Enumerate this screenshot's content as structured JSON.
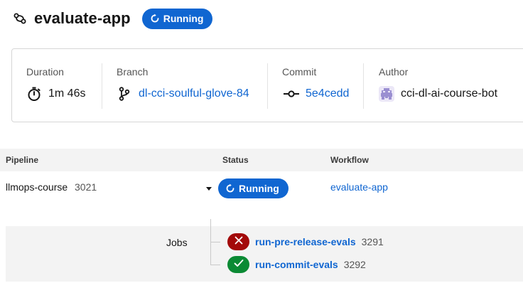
{
  "header": {
    "title": "evaluate-app",
    "status": "Running"
  },
  "summary": {
    "duration": {
      "label": "Duration",
      "value": "1m 46s"
    },
    "branch": {
      "label": "Branch",
      "value": "dl-cci-soulful-glove-84"
    },
    "commit": {
      "label": "Commit",
      "value": "5e4cedd"
    },
    "author": {
      "label": "Author",
      "value": "cci-dl-ai-course-bot"
    }
  },
  "table": {
    "headers": {
      "pipeline": "Pipeline",
      "status": "Status",
      "workflow": "Workflow"
    },
    "row": {
      "pipeline_name": "llmops-course",
      "pipeline_number": "3021",
      "status": "Running",
      "workflow": "evaluate-app"
    }
  },
  "jobs": {
    "label": "Jobs",
    "items": [
      {
        "name": "run-pre-release-evals",
        "number": "3291",
        "status": "failed",
        "icon": "x-icon"
      },
      {
        "name": "run-commit-evals",
        "number": "3292",
        "status": "success",
        "icon": "check-icon"
      }
    ]
  },
  "colors": {
    "accent": "#1066d1",
    "failed": "#a30a0a",
    "success": "#0b8a34",
    "text": "#161616",
    "muted": "#555555",
    "panel_bg": "#f3f3f3"
  }
}
